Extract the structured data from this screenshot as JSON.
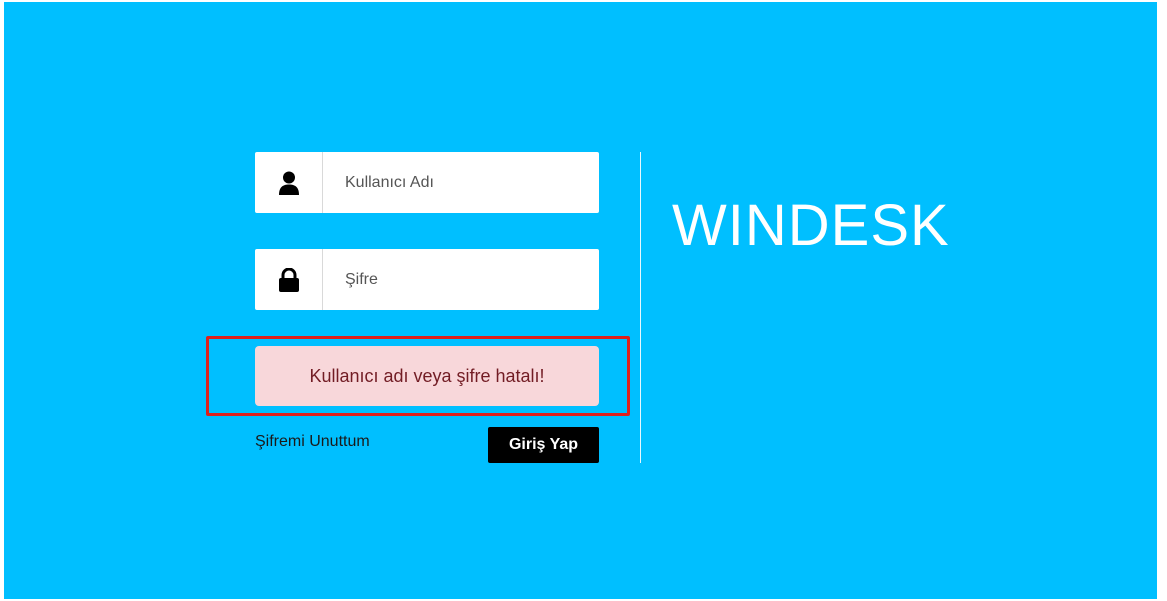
{
  "login_form": {
    "username": {
      "placeholder": "Kullanıcı Adı",
      "value": "",
      "icon": "user-icon"
    },
    "password": {
      "placeholder": "Şifre",
      "value": "",
      "icon": "lock-icon"
    },
    "error_message": "Kullanıcı adı veya şifre hatalı!",
    "forgot_link": "Şifremi Unuttum",
    "submit_label": "Giriş Yap"
  },
  "brand": {
    "name": "WINDESK"
  },
  "colors": {
    "background": "#00bfff",
    "alert_bg": "#f8d7da",
    "alert_text": "#721c24",
    "highlight_outline": "#e0201b",
    "button_bg": "#000000"
  }
}
